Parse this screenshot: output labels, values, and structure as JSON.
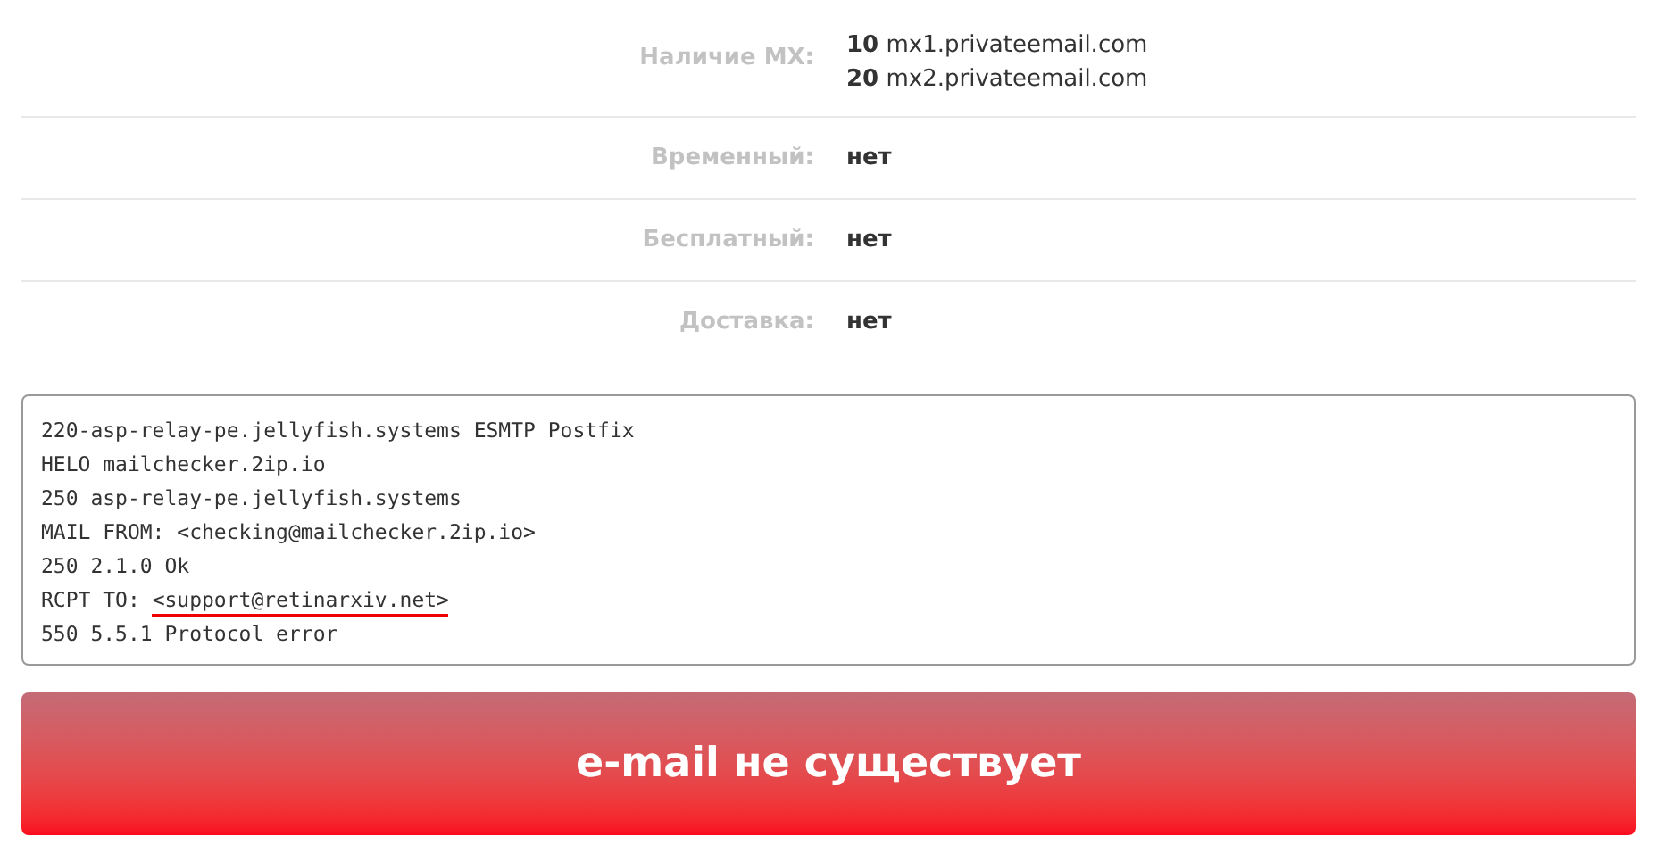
{
  "mx": {
    "label": "Наличие MX:",
    "records": [
      {
        "priority": "10",
        "host": "mx1.privateemail.com"
      },
      {
        "priority": "20",
        "host": "mx2.privateemail.com"
      }
    ]
  },
  "rows": [
    {
      "label": "Временный:",
      "value": "нет"
    },
    {
      "label": "Бесплатный:",
      "value": "нет"
    },
    {
      "label": "Доставка:",
      "value": "нет"
    }
  ],
  "log": [
    {
      "text": "220-asp-relay-pe.jellyfish.systems ESMTP Postfix"
    },
    {
      "text": "HELO mailchecker.2ip.io"
    },
    {
      "text": "250 asp-relay-pe.jellyfish.systems"
    },
    {
      "text": "MAIL FROM: <checking@mailchecker.2ip.io>"
    },
    {
      "text": "250 2.1.0 Ok"
    },
    {
      "text": "RCPT TO: ",
      "underlined": "<support@retinarxiv.net>"
    },
    {
      "text": "550 5.5.1 Protocol error"
    }
  ],
  "result": "e-mail не существует"
}
